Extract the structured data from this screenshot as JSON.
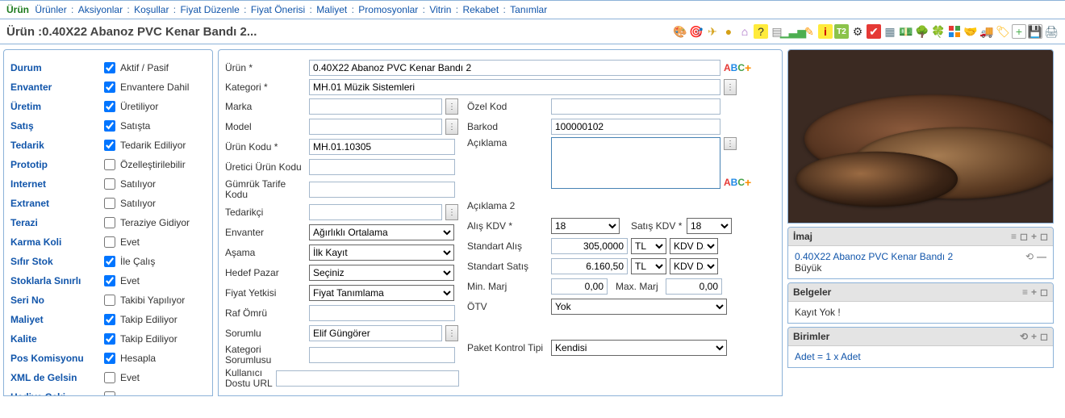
{
  "topnav": {
    "items": [
      "Ürün",
      "Ürünler",
      "Aksiyonlar",
      "Koşullar",
      "Fiyat Düzenle",
      "Fiyat Önerisi",
      "Maliyet",
      "Promosyonlar",
      "Vitrin",
      "Rekabet",
      "Tanımlar"
    ],
    "active_index": 0
  },
  "title": "Ürün :0.40X22 Abanoz PVC Kenar Bandı 2...",
  "left": [
    {
      "label": "Durum",
      "cb_label": "Aktif / Pasif",
      "checked": true
    },
    {
      "label": "Envanter",
      "cb_label": "Envantere Dahil",
      "checked": true
    },
    {
      "label": "Üretim",
      "cb_label": "Üretiliyor",
      "checked": true
    },
    {
      "label": "Satış",
      "cb_label": "Satışta",
      "checked": true
    },
    {
      "label": "Tedarik",
      "cb_label": "Tedarik Ediliyor",
      "checked": true
    },
    {
      "label": "Prototip",
      "cb_label": "Özelleştirilebilir",
      "checked": false
    },
    {
      "label": "Internet",
      "cb_label": "Satılıyor",
      "checked": false
    },
    {
      "label": "Extranet",
      "cb_label": "Satılıyor",
      "checked": false
    },
    {
      "label": "Terazi",
      "cb_label": "Teraziye Gidiyor",
      "checked": false
    },
    {
      "label": "Karma Koli",
      "cb_label": "Evet",
      "checked": false
    },
    {
      "label": "Sıfır Stok",
      "cb_label": "İle Çalış",
      "checked": true
    },
    {
      "label": "Stoklarla Sınırlı",
      "cb_label": "Evet",
      "checked": true
    },
    {
      "label": "Seri No",
      "cb_label": "Takibi Yapılıyor",
      "checked": false
    },
    {
      "label": "Maliyet",
      "cb_label": "Takip Ediliyor",
      "checked": true
    },
    {
      "label": "Kalite",
      "cb_label": "Takip Ediliyor",
      "checked": true
    },
    {
      "label": "Pos Komisyonu",
      "cb_label": "Hesapla",
      "checked": true
    },
    {
      "label": "XML de Gelsin",
      "cb_label": "Evet",
      "checked": false
    },
    {
      "label": "Hediye Çeki",
      "cb_label": "",
      "checked": false
    }
  ],
  "form": {
    "urun_label": "Ürün *",
    "urun": "0.40X22 Abanoz PVC Kenar Bandı 2",
    "kategori_label": "Kategori *",
    "kategori": "MH.01 Müzik Sistemleri",
    "marka_label": "Marka",
    "marka": "",
    "model_label": "Model",
    "model": "",
    "urun_kodu_label": "Ürün Kodu *",
    "urun_kodu": "MH.01.10305",
    "uretici_kodu_label": "Üretici Ürün Kodu",
    "uretici_kodu": "",
    "gumruk_label": "Gümrük Tarife Kodu",
    "gumruk": "",
    "tedarikci_label": "Tedarikçi",
    "tedarikci": "",
    "envanter_label": "Envanter",
    "envanter": "Ağırlıklı Ortalama",
    "asama_label": "Aşama",
    "asama": "İlk Kayıt",
    "hedef_label": "Hedef Pazar",
    "hedef": "Seçiniz",
    "yetki_label": "Fiyat Yetkisi",
    "yetki": "Fiyat Tanımlama",
    "raf_label": "Raf Ömrü",
    "raf": "",
    "sorumlu_label": "Sorumlu",
    "sorumlu": "Elif Güngörer",
    "kat_sorumlu_label": "Kategori Sorumlusu",
    "kat_sorumlu": "",
    "url_label": "Kullanıcı Dostu URL",
    "url": "",
    "ozelkod_label": "Özel Kod",
    "ozelkod": "",
    "barkod_label": "Barkod",
    "barkod": "100000102",
    "aciklama_label": "Açıklama",
    "aciklama": "",
    "aciklama2_label": "Açıklama 2",
    "aciklama2": "",
    "alis_kdv_label": "Alış KDV *",
    "alis_kdv": "18",
    "satis_kdv_label": "Satış KDV *",
    "satis_kdv": "18",
    "std_alis_label": "Standart Alış",
    "std_alis": "305,0000",
    "std_alis_curr": "TL",
    "std_alis_type": "KDV D.",
    "std_satis_label": "Standart Satış",
    "std_satis": "6.160,50",
    "std_satis_curr": "TL",
    "std_satis_type": "KDV D.",
    "min_marj_label": "Min. Marj",
    "min_marj": "0,00",
    "max_marj_label": "Max. Marj",
    "max_marj": "0,00",
    "otv_label": "ÖTV",
    "otv": "Yok",
    "paket_label": "Paket Kontrol Tipi",
    "paket": "Kendisi"
  },
  "right": {
    "imaj_title": "İmaj",
    "imaj_link": "0.40X22 Abanoz PVC Kenar Bandı 2",
    "imaj_sub": "Büyük",
    "belgeler_title": "Belgeler",
    "belgeler_body": "Kayıt Yok !",
    "birimler_title": "Birimler",
    "birimler_item": "Adet = 1 x Adet"
  }
}
